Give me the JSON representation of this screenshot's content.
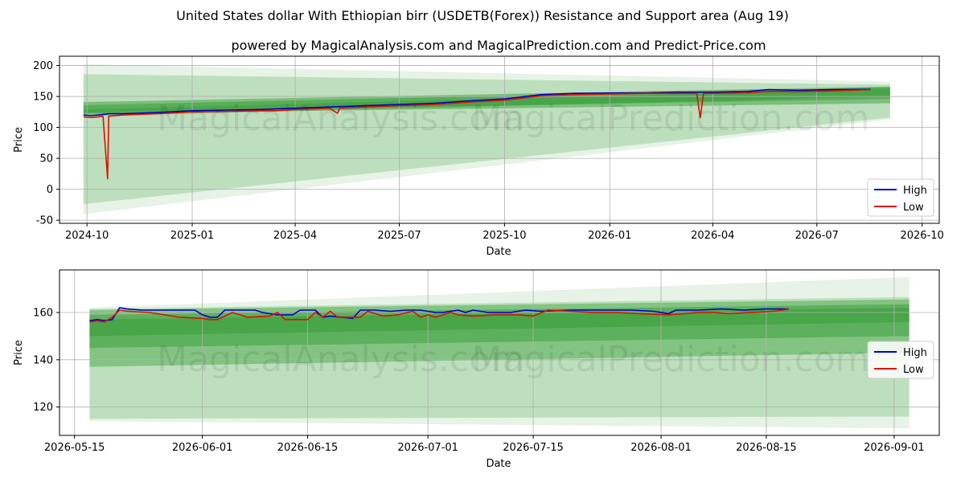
{
  "title": "United States dollar With Ethiopian birr (USDETB(Forex)) Resistance and Support area (Aug 19)",
  "subtitle": "powered by MagicalAnalysis.com and MagicalPrediction.com and Predict-Price.com",
  "watermarks": [
    "MagicalAnalysis.com",
    "MagicalPrediction.com"
  ],
  "colors": {
    "high": "#0000cc",
    "low": "#dd1100",
    "band": "#2e9a2e",
    "grid": "#b0b0b0"
  },
  "chart_data": [
    {
      "type": "line",
      "xlabel": "Date",
      "ylabel": "Price",
      "xlim": [
        "2024-09-07",
        "2026-10-16"
      ],
      "ylim": [
        -55,
        215
      ],
      "x_ticks": [
        "2024-10",
        "2025-01",
        "2025-04",
        "2025-07",
        "2025-10",
        "2026-01",
        "2026-04",
        "2026-07",
        "2026-10"
      ],
      "y_ticks": [
        -50,
        0,
        50,
        100,
        150,
        200
      ],
      "grid": true,
      "legend_position": "lower-right",
      "series": [
        {
          "name": "High",
          "color": "#0000cc",
          "points": [
            [
              "2024-09-28",
              120
            ],
            [
              "2024-10-05",
              119
            ],
            [
              "2024-10-15",
              121
            ],
            [
              "2024-10-20",
              122
            ],
            [
              "2024-11-01",
              122
            ],
            [
              "2024-12-01",
              124
            ],
            [
              "2025-01-01",
              127
            ],
            [
              "2025-02-01",
              128
            ],
            [
              "2025-03-01",
              129
            ],
            [
              "2025-04-01",
              131
            ],
            [
              "2025-05-01",
              133
            ],
            [
              "2025-06-01",
              135
            ],
            [
              "2025-07-01",
              137
            ],
            [
              "2025-08-01",
              139
            ],
            [
              "2025-09-01",
              143
            ],
            [
              "2025-10-01",
              146
            ],
            [
              "2025-10-20",
              150
            ],
            [
              "2025-11-01",
              153
            ],
            [
              "2025-12-01",
              155
            ],
            [
              "2026-01-01",
              155.5
            ],
            [
              "2026-02-01",
              156
            ],
            [
              "2026-03-01",
              157
            ],
            [
              "2026-04-01",
              157
            ],
            [
              "2026-05-01",
              158
            ],
            [
              "2026-05-20",
              161
            ],
            [
              "2026-06-15",
              160
            ],
            [
              "2026-07-15",
              161
            ],
            [
              "2026-08-17",
              161.5
            ]
          ]
        },
        {
          "name": "Low",
          "color": "#dd1100",
          "points": [
            [
              "2024-09-28",
              117
            ],
            [
              "2024-10-05",
              116
            ],
            [
              "2024-10-15",
              118
            ],
            [
              "2024-10-19",
              17
            ],
            [
              "2024-10-20",
              118
            ],
            [
              "2024-11-01",
              120
            ],
            [
              "2024-12-01",
              122
            ],
            [
              "2025-01-01",
              125
            ],
            [
              "2025-02-01",
              126
            ],
            [
              "2025-03-01",
              127
            ],
            [
              "2025-03-15",
              127
            ],
            [
              "2025-04-01",
              129
            ],
            [
              "2025-05-01",
              131
            ],
            [
              "2025-05-08",
              123
            ],
            [
              "2025-05-10",
              131
            ],
            [
              "2025-06-01",
              133
            ],
            [
              "2025-07-01",
              135
            ],
            [
              "2025-08-01",
              137
            ],
            [
              "2025-09-01",
              141
            ],
            [
              "2025-10-01",
              144
            ],
            [
              "2025-10-20",
              148
            ],
            [
              "2025-11-01",
              151
            ],
            [
              "2025-12-01",
              153
            ],
            [
              "2026-01-01",
              154
            ],
            [
              "2026-02-01",
              155
            ],
            [
              "2026-03-01",
              155
            ],
            [
              "2026-03-18",
              155
            ],
            [
              "2026-03-21",
              116
            ],
            [
              "2026-03-24",
              155
            ],
            [
              "2026-04-01",
              155
            ],
            [
              "2026-05-01",
              156
            ],
            [
              "2026-05-20",
              158
            ],
            [
              "2026-06-15",
              158
            ],
            [
              "2026-07-15",
              159
            ],
            [
              "2026-08-17",
              161
            ]
          ]
        }
      ],
      "bands": [
        {
          "upper": [
            202,
            174
          ],
          "lower": [
            -40,
            113
          ],
          "opacity": 0.12
        },
        {
          "upper": [
            186,
            169
          ],
          "lower": [
            -24,
            116
          ],
          "opacity": 0.22
        },
        {
          "upper": [
            141,
            166
          ],
          "lower": [
            122,
            139
          ],
          "opacity": 0.45
        },
        {
          "upper": [
            136,
            165
          ],
          "lower": [
            124,
            146
          ],
          "opacity": 0.45
        },
        {
          "upper": [
            129,
            163
          ],
          "lower": [
            118,
            150
          ],
          "opacity": 0.4
        }
      ],
      "band_range": [
        "2024-09-28",
        "2026-09-03"
      ]
    },
    {
      "type": "line",
      "xlabel": "Date",
      "ylabel": "Price",
      "xlim": [
        "2026-05-13",
        "2026-09-07"
      ],
      "ylim": [
        108,
        178
      ],
      "x_ticks": [
        "2026-05-15",
        "2026-06-01",
        "2026-06-15",
        "2026-07-01",
        "2026-07-15",
        "2026-08-01",
        "2026-08-15",
        "2026-09-01"
      ],
      "y_ticks": [
        120,
        140,
        160
      ],
      "grid": true,
      "legend_position": "center-right",
      "series": [
        {
          "name": "High",
          "color": "#0000cc",
          "points": [
            [
              "2026-05-17",
              156.5
            ],
            [
              "2026-05-18",
              157
            ],
            [
              "2026-05-19",
              156.5
            ],
            [
              "2026-05-20",
              157
            ],
            [
              "2026-05-21",
              162
            ],
            [
              "2026-05-22",
              161.5
            ],
            [
              "2026-05-24",
              161
            ],
            [
              "2026-05-27",
              161
            ],
            [
              "2026-05-31",
              161
            ],
            [
              "2026-06-01",
              159
            ],
            [
              "2026-06-02",
              158
            ],
            [
              "2026-06-03",
              158
            ],
            [
              "2026-06-04",
              161
            ],
            [
              "2026-06-07",
              161
            ],
            [
              "2026-06-08",
              161
            ],
            [
              "2026-06-09",
              160
            ],
            [
              "2026-06-11",
              159
            ],
            [
              "2026-06-13",
              159
            ],
            [
              "2026-06-14",
              161
            ],
            [
              "2026-06-16",
              161
            ],
            [
              "2026-06-17",
              158
            ],
            [
              "2026-06-18",
              158.5
            ],
            [
              "2026-06-21",
              157.5
            ],
            [
              "2026-06-22",
              161
            ],
            [
              "2026-06-24",
              161
            ],
            [
              "2026-06-26",
              160.5
            ],
            [
              "2026-06-28",
              161
            ],
            [
              "2026-06-29",
              161
            ],
            [
              "2026-06-30",
              161
            ],
            [
              "2026-07-02",
              160
            ],
            [
              "2026-07-03",
              160
            ],
            [
              "2026-07-05",
              161
            ],
            [
              "2026-07-06",
              160
            ],
            [
              "2026-07-07",
              161
            ],
            [
              "2026-07-09",
              160
            ],
            [
              "2026-07-12",
              160
            ],
            [
              "2026-07-14",
              161
            ],
            [
              "2026-07-16",
              160.5
            ],
            [
              "2026-07-20",
              161
            ],
            [
              "2026-07-24",
              161
            ],
            [
              "2026-07-28",
              161
            ],
            [
              "2026-07-31",
              160.5
            ],
            [
              "2026-08-02",
              159.5
            ],
            [
              "2026-08-03",
              161
            ],
            [
              "2026-08-06",
              161
            ],
            [
              "2026-08-09",
              161.5
            ],
            [
              "2026-08-12",
              161
            ],
            [
              "2026-08-15",
              161.5
            ],
            [
              "2026-08-18",
              161.5
            ]
          ]
        },
        {
          "name": "Low",
          "color": "#dd1100",
          "points": [
            [
              "2026-05-17",
              156
            ],
            [
              "2026-05-18",
              156.5
            ],
            [
              "2026-05-19",
              156
            ],
            [
              "2026-05-20",
              158
            ],
            [
              "2026-05-21",
              161
            ],
            [
              "2026-05-22",
              160.5
            ],
            [
              "2026-05-25",
              160
            ],
            [
              "2026-05-27",
              159
            ],
            [
              "2026-05-29",
              158
            ],
            [
              "2026-06-01",
              157.5
            ],
            [
              "2026-06-02",
              157
            ],
            [
              "2026-06-03",
              157
            ],
            [
              "2026-06-05",
              160
            ],
            [
              "2026-06-07",
              158
            ],
            [
              "2026-06-10",
              158.5
            ],
            [
              "2026-06-11",
              160
            ],
            [
              "2026-06-12",
              157
            ],
            [
              "2026-06-15",
              157
            ],
            [
              "2026-06-16",
              160
            ],
            [
              "2026-06-17",
              158
            ],
            [
              "2026-06-18",
              160.5
            ],
            [
              "2026-06-19",
              158
            ],
            [
              "2026-06-22",
              158
            ],
            [
              "2026-06-23",
              160.5
            ],
            [
              "2026-06-25",
              158.5
            ],
            [
              "2026-06-27",
              159
            ],
            [
              "2026-06-29",
              160.5
            ],
            [
              "2026-06-30",
              158
            ],
            [
              "2026-07-01",
              159
            ],
            [
              "2026-07-02",
              158
            ],
            [
              "2026-07-04",
              160
            ],
            [
              "2026-07-05",
              159
            ],
            [
              "2026-07-07",
              158.5
            ],
            [
              "2026-07-10",
              159
            ],
            [
              "2026-07-13",
              159
            ],
            [
              "2026-07-15",
              158.5
            ],
            [
              "2026-07-17",
              161
            ],
            [
              "2026-07-20",
              160.5
            ],
            [
              "2026-07-23",
              160
            ],
            [
              "2026-07-26",
              160
            ],
            [
              "2026-07-29",
              159.5
            ],
            [
              "2026-08-02",
              159
            ],
            [
              "2026-08-04",
              159.5
            ],
            [
              "2026-08-06",
              160
            ],
            [
              "2026-08-08",
              160
            ],
            [
              "2026-08-10",
              159.5
            ],
            [
              "2026-08-13",
              160
            ],
            [
              "2026-08-16",
              160.5
            ],
            [
              "2026-08-18",
              161.5
            ]
          ]
        }
      ],
      "bands": [
        {
          "upper": [
            162,
            175
          ],
          "lower": [
            114,
            111
          ],
          "opacity": 0.12
        },
        {
          "upper": [
            161.5,
            166.5
          ],
          "lower": [
            115,
            116
          ],
          "opacity": 0.22
        },
        {
          "upper": [
            161,
            165.5
          ],
          "lower": [
            137,
            143
          ],
          "opacity": 0.4
        },
        {
          "upper": [
            159,
            163.5
          ],
          "lower": [
            145,
            150
          ],
          "opacity": 0.45
        },
        {
          "upper": [
            157,
            162
          ],
          "lower": [
            150,
            156
          ],
          "opacity": 0.45
        }
      ],
      "band_range": [
        "2026-05-17",
        "2026-09-03"
      ]
    }
  ]
}
